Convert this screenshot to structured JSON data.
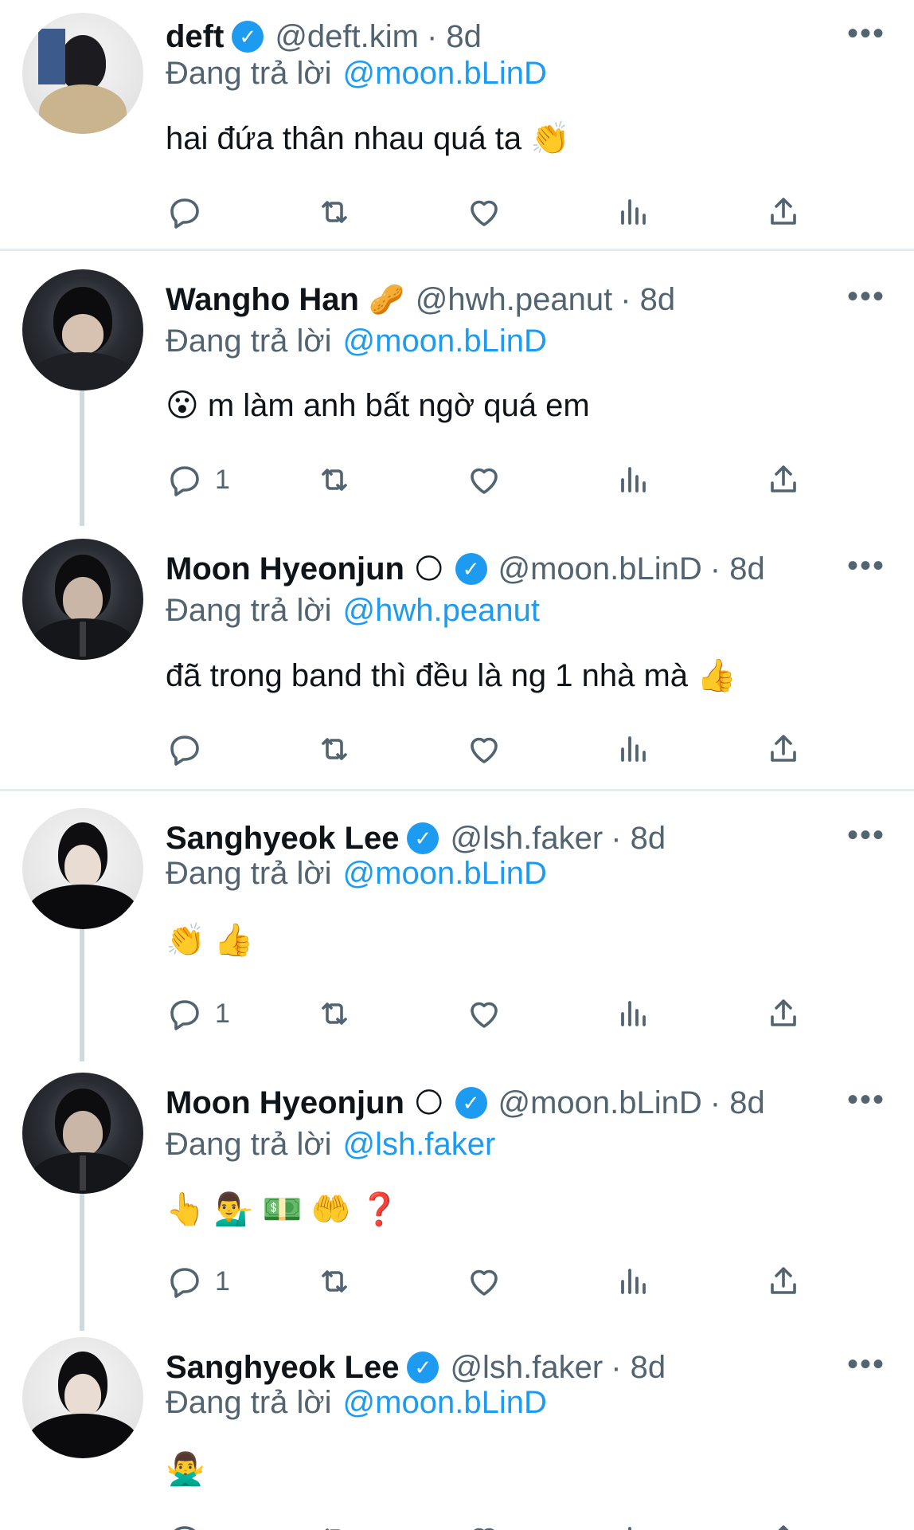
{
  "reply_prefix": "Đang trả lời",
  "tweets": [
    {
      "name": "deft",
      "verified": "✓",
      "handle": "@deft.kim",
      "time": "· 8d",
      "reply_to": "@moon.bLinD",
      "text": "hai đứa thân nhau quá ta 👏",
      "reply_count": ""
    },
    {
      "name": "Wangho Han",
      "name_emoji": "🥜",
      "handle": "@hwh.peanut",
      "time": "· 8d",
      "reply_to": "@moon.bLinD",
      "text": "😮 m làm anh bất ngờ quá em",
      "reply_count": "1"
    },
    {
      "name": "Moon Hyeonjun",
      "name_emoji": "🌕",
      "verified": "✓",
      "handle": "@moon.bLinD",
      "time": "· 8d",
      "reply_to": "@hwh.peanut",
      "text": "đã trong band thì đều là ng 1 nhà mà 👍",
      "reply_count": ""
    },
    {
      "name": "Sanghyeok Lee",
      "verified": "✓",
      "handle": "@lsh.faker",
      "time": "· 8d",
      "reply_to": "@moon.bLinD",
      "text": "👏 👍",
      "reply_count": "1"
    },
    {
      "name": "Moon Hyeonjun",
      "name_emoji": "🌕",
      "verified": "✓",
      "handle": "@moon.bLinD",
      "time": "· 8d",
      "reply_to": "@lsh.faker",
      "text": "👆 💁‍♂️ 💵 🤲 ❓",
      "reply_count": "1"
    },
    {
      "name": "Sanghyeok Lee",
      "verified": "✓",
      "handle": "@lsh.faker",
      "time": "· 8d",
      "reply_to": "@moon.bLinD",
      "text": "🙅‍♂️",
      "reply_count": ""
    }
  ],
  "more_label": "•••",
  "colors": {
    "link": "#1d9bf0",
    "muted": "#536471",
    "text": "#0f1419",
    "thread_line": "#cfd9de"
  },
  "icons": [
    "reply-icon",
    "retweet-icon",
    "like-icon",
    "views-icon",
    "share-icon",
    "more-icon",
    "verified-badge-icon"
  ]
}
